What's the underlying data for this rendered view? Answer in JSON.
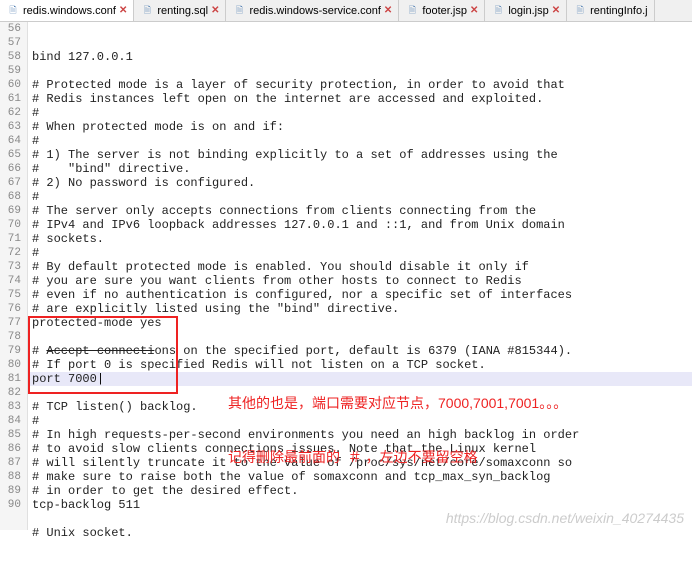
{
  "tabs": [
    {
      "label": "redis.windows.conf",
      "active": true
    },
    {
      "label": "renting.sql",
      "active": false
    },
    {
      "label": "redis.windows-service.conf",
      "active": false
    },
    {
      "label": "footer.jsp",
      "active": false
    },
    {
      "label": "login.jsp",
      "active": false
    },
    {
      "label": "rentingInfo.j",
      "active": false
    }
  ],
  "first_line_no": 56,
  "lines": [
    "bind 127.0.0.1",
    "",
    "# Protected mode is a layer of security protection, in order to avoid that",
    "# Redis instances left open on the internet are accessed and exploited.",
    "#",
    "# When protected mode is on and if:",
    "#",
    "# 1) The server is not binding explicitly to a set of addresses using the",
    "#    \"bind\" directive.",
    "# 2) No password is configured.",
    "#",
    "# The server only accepts connections from clients connecting from the",
    "# IPv4 and IPv6 loopback addresses 127.0.0.1 and ::1, and from Unix domain",
    "# sockets.",
    "#",
    "# By default protected mode is enabled. You should disable it only if",
    "# you are sure you want clients from other hosts to connect to Redis",
    "# even if no authentication is configured, nor a specific set of interfaces",
    "# are explicitly listed using the \"bind\" directive.",
    "protected-mode yes",
    "",
    "# Accept connections on the specified port, default is 6379 (IANA #815344).",
    "# If port 0 is specified Redis will not listen on a TCP socket.",
    "port 7000",
    "",
    "# TCP listen() backlog.",
    "#",
    "# In high requests-per-second environments you need an high backlog in order",
    "# to avoid slow clients connections issues. Note that the Linux kernel",
    "# will silently truncate it to the value of /proc/sys/net/core/somaxconn so",
    "# make sure to raise both the value of somaxconn and tcp_max_syn_backlog",
    "# in order to get the desired effect.",
    "tcp-backlog 511",
    "",
    "# Unix socket."
  ],
  "strike_segment": {
    "line_index": 21,
    "prefix": "# ",
    "struck": "Accept connecti",
    "suffix": "ons on the specified port, default is 6379 (IANA #815344)."
  },
  "highlight_line_index": 23,
  "annotation": {
    "line1": "其他的也是，端口需要对应节点，7000,7001,7001。。。",
    "line2": "记得删除最前面的  ＃ ，左边不要留空格"
  },
  "watermark": "https://blog.csdn.net/weixin_40274435",
  "close_glyph": "✕",
  "file_glyph": "🗎"
}
